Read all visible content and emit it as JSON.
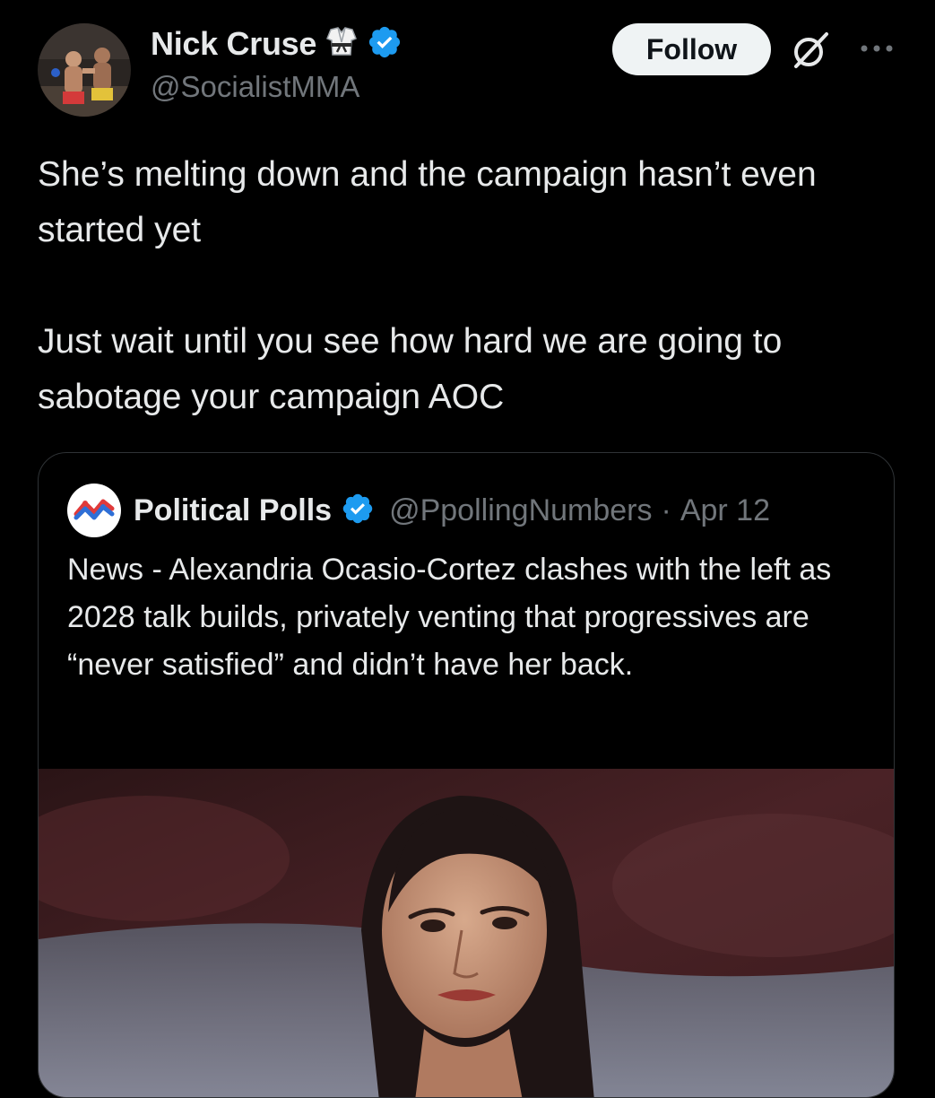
{
  "post": {
    "author": {
      "display_name": "Nick Cruse",
      "handle": "@SocialistMMA",
      "badge_icon": "karate-gi-emoji",
      "verified_icon": "verified-badge-icon"
    },
    "follow_label": "Follow",
    "text_paragraphs": [
      "She’s melting down and the campaign hasn’t even started yet",
      "Just wait until you see how hard we are going to sabotage your campaign AOC"
    ]
  },
  "quote": {
    "author": {
      "display_name": "Political Polls",
      "handle": "@PpollingNumbers",
      "verified_icon": "verified-badge-icon"
    },
    "separator": "·",
    "date": "Apr 12",
    "text": "News - Alexandria Ocasio-Cortez clashes with the left as 2028 talk builds, privately venting that progressives are “never satisfied” and didn’t have her back."
  },
  "colors": {
    "background": "#000000",
    "text_primary": "#e7e9ea",
    "text_secondary": "#71767b",
    "verified_blue": "#1d9bf0",
    "border": "#2f3336",
    "follow_bg": "#eff3f4"
  }
}
